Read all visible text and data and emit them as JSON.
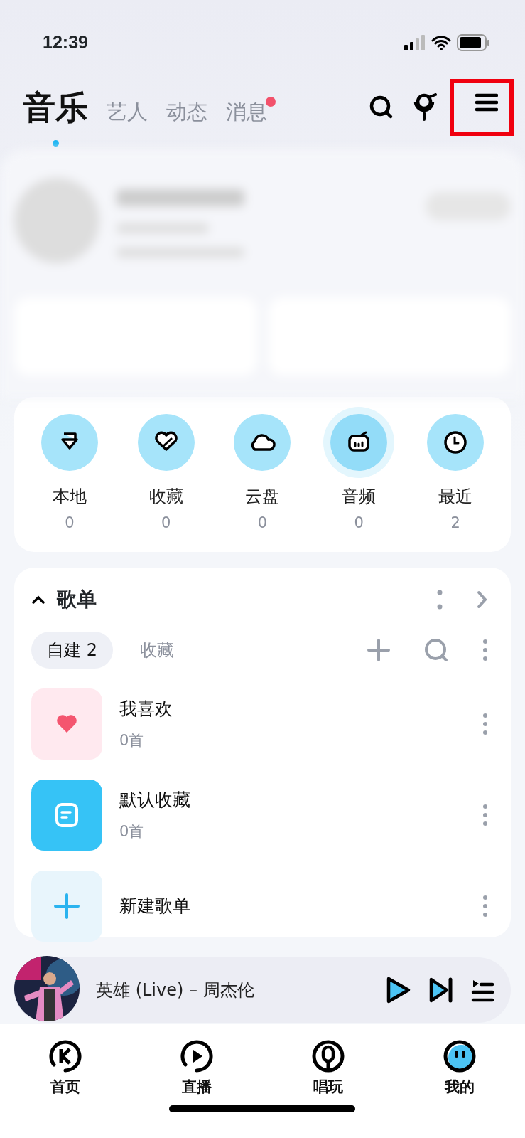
{
  "status_bar": {
    "time": "12:39"
  },
  "header": {
    "tabs": [
      {
        "label": "音乐",
        "selected": true,
        "badge": false
      },
      {
        "label": "艺人",
        "selected": false,
        "badge": false
      },
      {
        "label": "动态",
        "selected": false,
        "badge": false
      },
      {
        "label": "消息",
        "selected": false,
        "badge": true
      }
    ],
    "menu_highlighted": true
  },
  "quick_access": [
    {
      "kind": "local",
      "label": "本地",
      "count": "0",
      "glow": false
    },
    {
      "kind": "favorite",
      "label": "收藏",
      "count": "0",
      "glow": false
    },
    {
      "kind": "cloud",
      "label": "云盘",
      "count": "0",
      "glow": false
    },
    {
      "kind": "audio",
      "label": "音频",
      "count": "0",
      "glow": true
    },
    {
      "kind": "recent",
      "label": "最近",
      "count": "2",
      "glow": false
    }
  ],
  "playlists": {
    "title": "歌单",
    "expanded": true,
    "tabs": [
      {
        "label": "自建 2",
        "selected": true
      },
      {
        "label": "收藏",
        "selected": false
      }
    ],
    "items": [
      {
        "kind": "liked",
        "title": "我喜欢",
        "count": "0首"
      },
      {
        "kind": "default",
        "title": "默认收藏",
        "count": "0首"
      },
      {
        "kind": "new",
        "title": "新建歌单"
      }
    ]
  },
  "player": {
    "track": "英雄 (Live) – 周杰伦"
  },
  "bottom_nav": [
    {
      "kind": "home",
      "label": "首页",
      "selected": false
    },
    {
      "kind": "live",
      "label": "直播",
      "selected": false
    },
    {
      "kind": "sing",
      "label": "唱玩",
      "selected": false
    },
    {
      "kind": "me",
      "label": "我的",
      "selected": true
    }
  ]
}
